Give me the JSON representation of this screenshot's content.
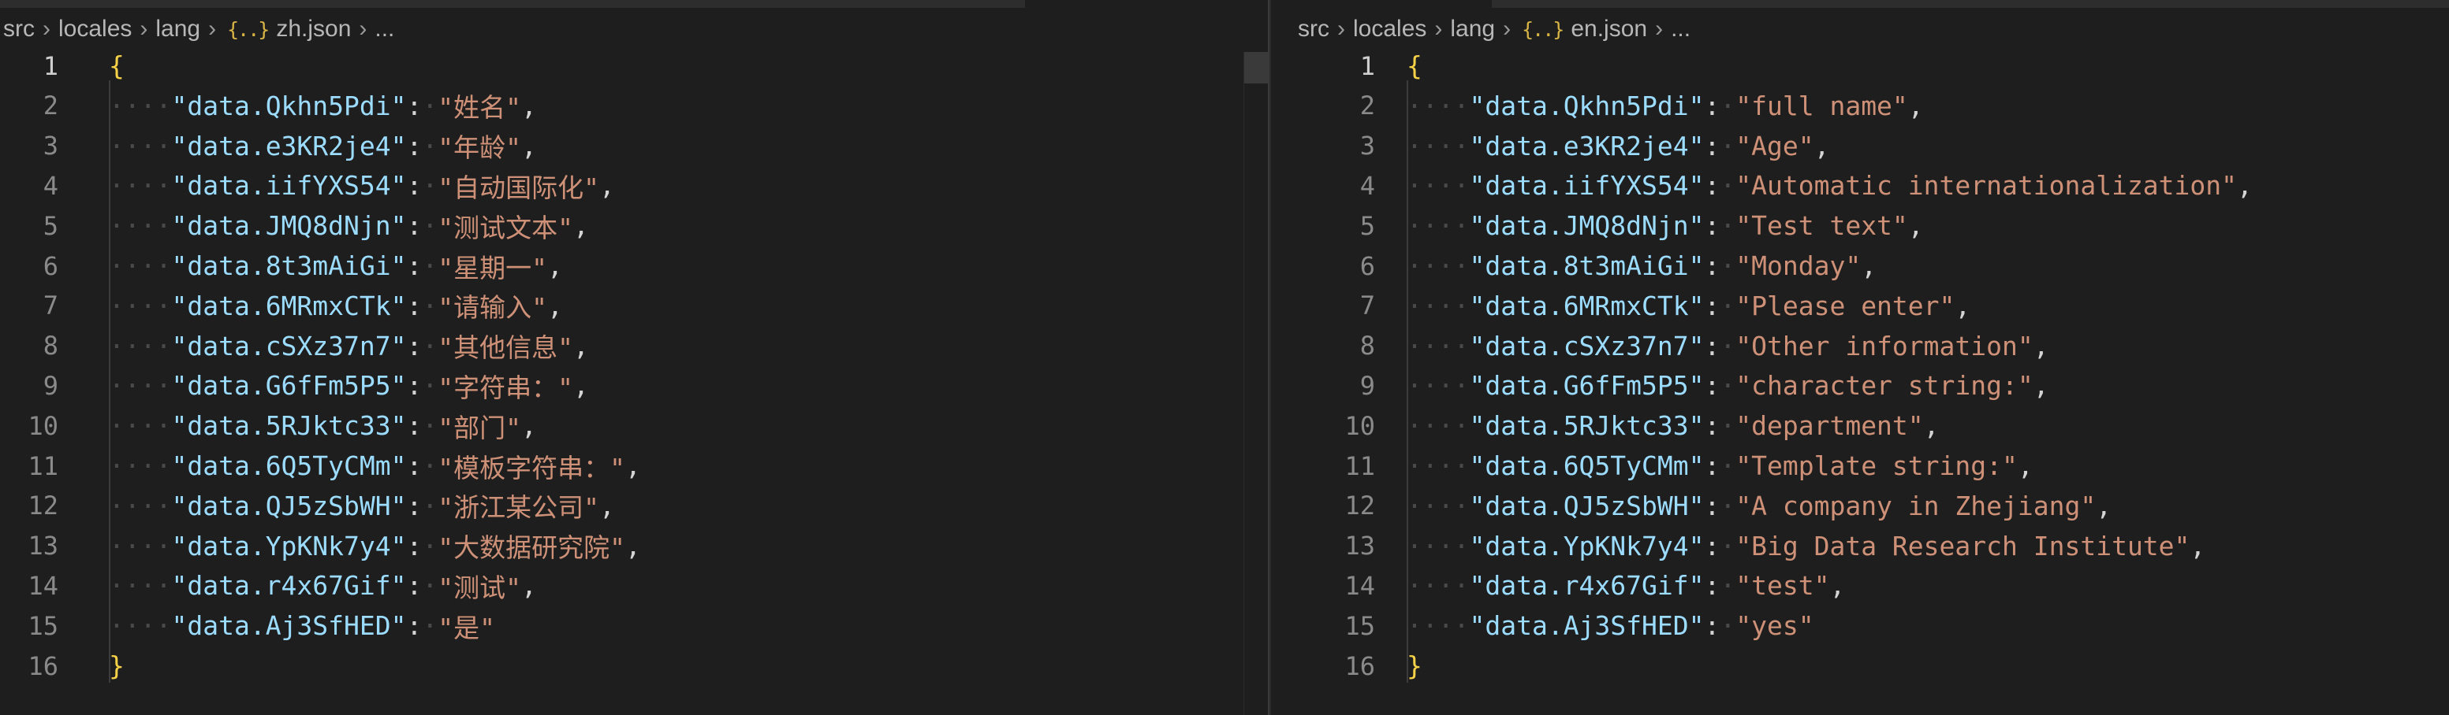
{
  "left": {
    "breadcrumb": {
      "parts": [
        "src",
        "locales",
        "lang"
      ],
      "file_icon": "{..}",
      "file": "zh.json",
      "ellipsis": "..."
    },
    "lines": [
      {
        "n": "1",
        "open": "{"
      },
      {
        "n": "2",
        "key": "\"data.Qkhn5Pdi\"",
        "value": "\"姓名\"",
        "comma": ","
      },
      {
        "n": "3",
        "key": "\"data.e3KR2je4\"",
        "value": "\"年龄\"",
        "comma": ","
      },
      {
        "n": "4",
        "key": "\"data.iifYXS54\"",
        "value": "\"自动国际化\"",
        "comma": ","
      },
      {
        "n": "5",
        "key": "\"data.JMQ8dNjn\"",
        "value": "\"测试文本\"",
        "comma": ","
      },
      {
        "n": "6",
        "key": "\"data.8t3mAiGi\"",
        "value": "\"星期一\"",
        "comma": ","
      },
      {
        "n": "7",
        "key": "\"data.6MRmxCTk\"",
        "value": "\"请输入\"",
        "comma": ","
      },
      {
        "n": "8",
        "key": "\"data.cSXz37n7\"",
        "value": "\"其他信息\"",
        "comma": ","
      },
      {
        "n": "9",
        "key": "\"data.G6fFm5P5\"",
        "value": "\"字符串：\"",
        "comma": ","
      },
      {
        "n": "10",
        "key": "\"data.5RJktc33\"",
        "value": "\"部门\"",
        "comma": ","
      },
      {
        "n": "11",
        "key": "\"data.6Q5TyCMm\"",
        "value": "\"模板字符串：\"",
        "comma": ","
      },
      {
        "n": "12",
        "key": "\"data.QJ5zSbWH\"",
        "value": "\"浙江某公司\"",
        "comma": ","
      },
      {
        "n": "13",
        "key": "\"data.YpKNk7y4\"",
        "value": "\"大数据研究院\"",
        "comma": ","
      },
      {
        "n": "14",
        "key": "\"data.r4x67Gif\"",
        "value": "\"测试\"",
        "comma": ","
      },
      {
        "n": "15",
        "key": "\"data.Aj3SfHED\"",
        "value": "\"是\"",
        "comma": ""
      },
      {
        "n": "16",
        "close": "}"
      }
    ]
  },
  "right": {
    "breadcrumb": {
      "parts": [
        "src",
        "locales",
        "lang"
      ],
      "file_icon": "{..}",
      "file": "en.json",
      "ellipsis": "..."
    },
    "lines": [
      {
        "n": "1",
        "open": "{"
      },
      {
        "n": "2",
        "key": "\"data.Qkhn5Pdi\"",
        "value": "\"full name\"",
        "comma": ","
      },
      {
        "n": "3",
        "key": "\"data.e3KR2je4\"",
        "value": "\"Age\"",
        "comma": ","
      },
      {
        "n": "4",
        "key": "\"data.iifYXS54\"",
        "value": "\"Automatic internationalization\"",
        "comma": ","
      },
      {
        "n": "5",
        "key": "\"data.JMQ8dNjn\"",
        "value": "\"Test text\"",
        "comma": ","
      },
      {
        "n": "6",
        "key": "\"data.8t3mAiGi\"",
        "value": "\"Monday\"",
        "comma": ","
      },
      {
        "n": "7",
        "key": "\"data.6MRmxCTk\"",
        "value": "\"Please enter\"",
        "comma": ","
      },
      {
        "n": "8",
        "key": "\"data.cSXz37n7\"",
        "value": "\"Other information\"",
        "comma": ","
      },
      {
        "n": "9",
        "key": "\"data.G6fFm5P5\"",
        "value": "\"character string:\"",
        "comma": ","
      },
      {
        "n": "10",
        "key": "\"data.5RJktc33\"",
        "value": "\"department\"",
        "comma": ","
      },
      {
        "n": "11",
        "key": "\"data.6Q5TyCMm\"",
        "value": "\"Template string:\"",
        "comma": ","
      },
      {
        "n": "12",
        "key": "\"data.QJ5zSbWH\"",
        "value": "\"A company in Zhejiang\"",
        "comma": ","
      },
      {
        "n": "13",
        "key": "\"data.YpKNk7y4\"",
        "value": "\"Big Data Research Institute\"",
        "comma": ","
      },
      {
        "n": "14",
        "key": "\"data.r4x67Gif\"",
        "value": "\"test\"",
        "comma": ","
      },
      {
        "n": "15",
        "key": "\"data.Aj3SfHED\"",
        "value": "\"yes\"",
        "comma": ""
      },
      {
        "n": "16",
        "close": "}"
      }
    ]
  },
  "colors": {
    "background": "#1e1e1e",
    "key": "#9cdcfe",
    "string": "#ce9178",
    "brace": "#f5d247",
    "line_number": "#8a8a8a"
  }
}
